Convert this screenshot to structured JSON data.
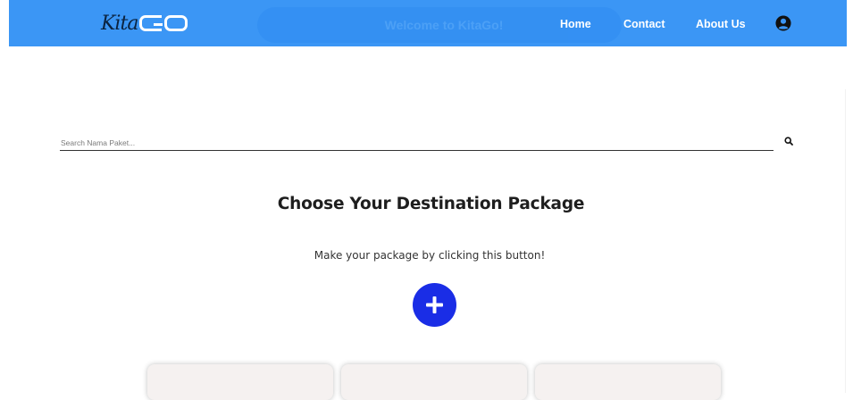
{
  "brand": {
    "script": "Kita",
    "block": "GO"
  },
  "header": {
    "welcome": "Welcome to KitaGo!",
    "nav": [
      "Home",
      "Contact",
      "About Us"
    ]
  },
  "search": {
    "placeholder": "Search Nama Paket..."
  },
  "main": {
    "title": "Choose Your Destination Package",
    "subtitle": "Make your package by clicking this button!"
  },
  "icons": {
    "user": "user-circle-icon",
    "search": "magnifier-icon",
    "add": "plus-icon"
  },
  "colors": {
    "navbar": "#3b96f5",
    "add_button": "#1a2de6",
    "card": "#f5f1f0"
  }
}
